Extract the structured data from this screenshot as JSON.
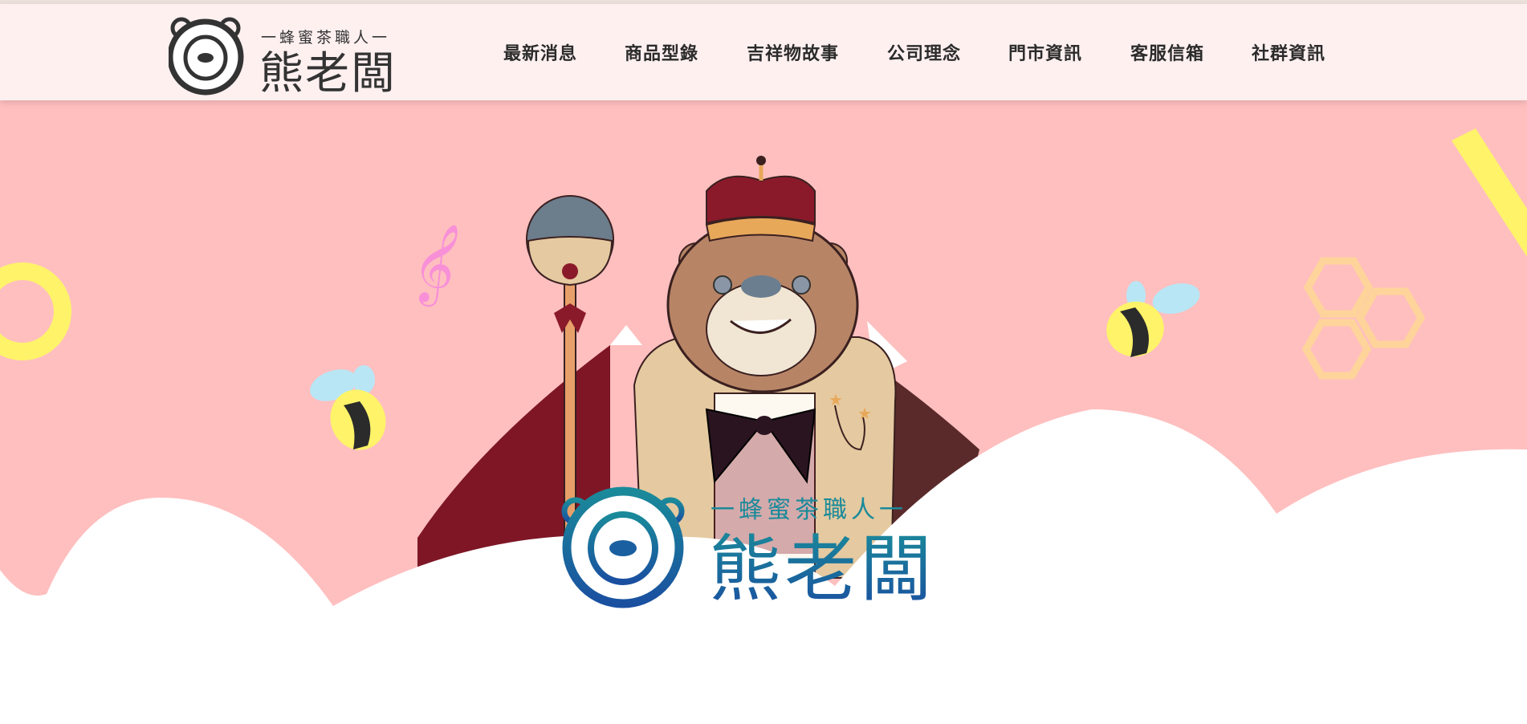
{
  "header": {
    "logo": {
      "tagline": "一蜂蜜茶職人一",
      "wordmark": "熊老闆"
    },
    "nav": [
      {
        "label": "最新消息"
      },
      {
        "label": "商品型錄"
      },
      {
        "label": "吉祥物故事"
      },
      {
        "label": "公司理念"
      },
      {
        "label": "門市資訊"
      },
      {
        "label": "客服信箱"
      },
      {
        "label": "社群資訊"
      }
    ]
  },
  "hero": {
    "brand_logo": {
      "tagline": "一蜂蜜茶職人一",
      "wordmark": "熊老闆"
    }
  },
  "colors": {
    "header_bg": "#fff0f0",
    "hero_bg": "#ffbfbf",
    "cloud": "#ffffff",
    "brand_teal": "#1a8a9a",
    "brand_blue": "#1a4fa0",
    "bee_yellow": "#fff36a",
    "honeycomb": "#ffd49a",
    "cape_red": "#7e1626"
  },
  "icons": [
    "bear-logo-icon",
    "treble-clef-icon",
    "bee-icon",
    "honeycomb-icon",
    "ring-icon",
    "crown-icon",
    "scepter-icon"
  ]
}
